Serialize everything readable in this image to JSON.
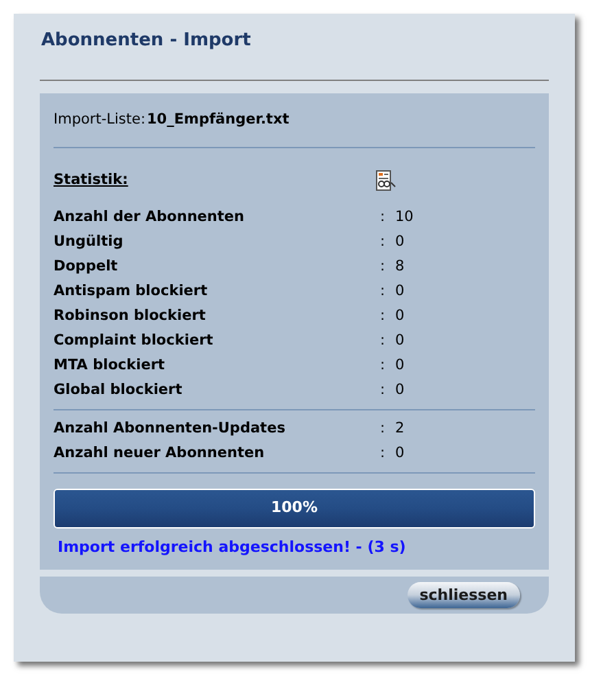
{
  "dialog": {
    "title": "Abonnenten - Import"
  },
  "import_list": {
    "label": "Import-Liste:",
    "value": "10_Empfänger.txt"
  },
  "statistics": {
    "heading": "Statistik:",
    "rows": [
      {
        "label": "Anzahl der Abonnenten",
        "separator": ":",
        "value": "10"
      },
      {
        "label": "Ungültig",
        "separator": ":",
        "value": "0"
      },
      {
        "label": "Doppelt",
        "separator": ":",
        "value": "8"
      },
      {
        "label": "Antispam blockiert",
        "separator": ":",
        "value": "0"
      },
      {
        "label": "Robinson blockiert",
        "separator": ":",
        "value": "0"
      },
      {
        "label": "Complaint blockiert",
        "separator": ":",
        "value": "0"
      },
      {
        "label": "MTA blockiert",
        "separator": ":",
        "value": "0"
      },
      {
        "label": "Global blockiert",
        "separator": ":",
        "value": "0"
      }
    ]
  },
  "updates": [
    {
      "label": "Anzahl Abonnenten-Updates",
      "separator": ":",
      "value": "2"
    },
    {
      "label": "Anzahl neuer Abonnenten",
      "separator": ":",
      "value": "0"
    }
  ],
  "progress": {
    "level": 1,
    "label": "100%"
  },
  "status_message": "Import erfolgreich abgeschlossen! - (3 s)",
  "buttons": [
    "schliessen"
  ]
}
